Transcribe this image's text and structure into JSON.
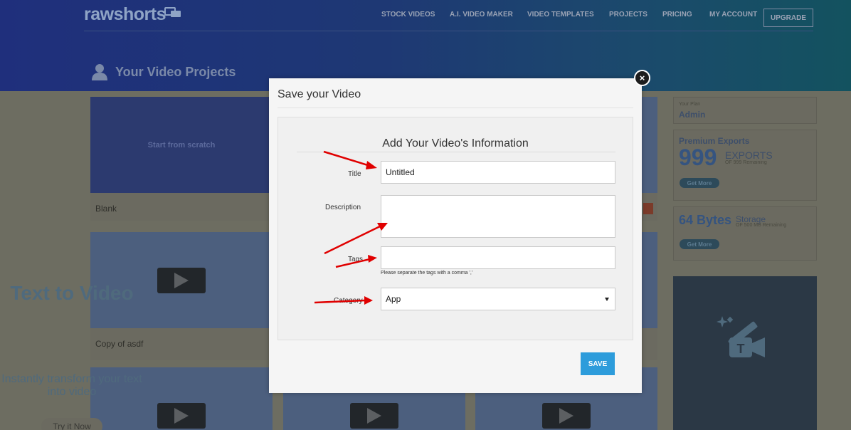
{
  "header": {
    "logo": "rawshorts",
    "nav": [
      "STOCK VIDEOS",
      "A.I. VIDEO MAKER",
      "VIDEO TEMPLATES",
      "PROJECTS",
      "PRICING",
      "MY ACCOUNT"
    ],
    "upgrade": "UPGRADE"
  },
  "page": {
    "title": "Your Video Projects",
    "cards": {
      "scratch": "Start from scratch",
      "blank": "Blank",
      "copy": "Copy of asdf"
    }
  },
  "sidebar": {
    "plan_label": "Your Plan",
    "plan_value": "Admin",
    "exports_title": "Premium Exports",
    "exports_count": "999",
    "exports_unit": "EXPORTS",
    "exports_remaining": "OF 999 Remaining",
    "get_more": "Get More",
    "storage_value": "64 Bytes",
    "storage_unit": "Storage",
    "storage_remaining": "OF 500 MB Remaining",
    "promo_title": "Text to Video",
    "promo_text": "Instantly transform your text into video",
    "promo_button": "Try it Now"
  },
  "modal": {
    "title": "Save your Video",
    "panel_title": "Add Your Video's Information",
    "title_label": "Title",
    "title_value": "Untitled",
    "description_label": "Description",
    "tags_label": "Tags",
    "tags_hint": "Please separate the tags with a comma ','",
    "category_label": "Category",
    "category_value": "App",
    "save": "SAVE",
    "close": "×"
  },
  "colors": {
    "accent": "#2d9cdb",
    "arrow": "#e00000"
  }
}
